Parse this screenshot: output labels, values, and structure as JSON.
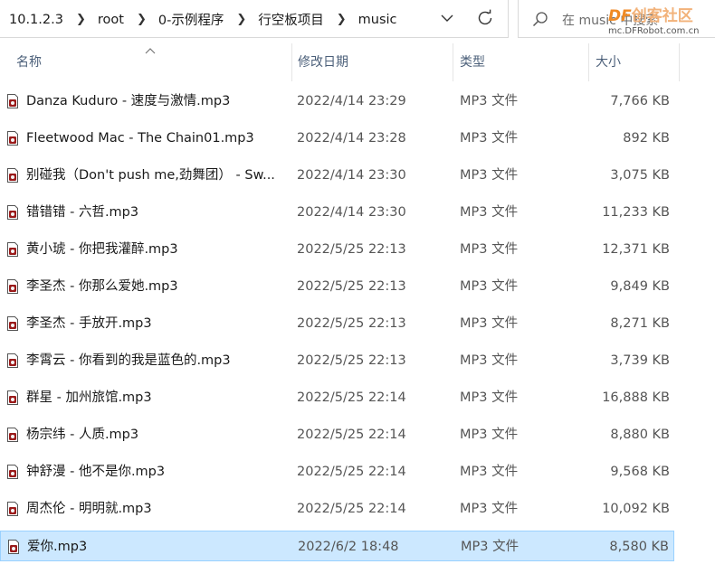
{
  "breadcrumb": [
    "10.1.2.3",
    "root",
    "0-示例程序",
    "行空板项目",
    "music"
  ],
  "search": {
    "placeholder": "在 music 中搜索"
  },
  "watermark": {
    "logo_df": "DF",
    "logo_cn": "创客社区",
    "url": "mc.DFRobot.com.cn"
  },
  "columns": {
    "name": "名称",
    "date": "修改日期",
    "type": "类型",
    "size": "大小"
  },
  "files": [
    {
      "name": "Danza Kuduro - 速度与激情.mp3",
      "date": "2022/4/14 23:29",
      "type": "MP3 文件",
      "size": "7,766 KB"
    },
    {
      "name": "Fleetwood Mac - The Chain01.mp3",
      "date": "2022/4/14 23:28",
      "type": "MP3 文件",
      "size": "892 KB"
    },
    {
      "name": "别碰我（Don't push me,劲舞团） - Sw...",
      "date": "2022/4/14 23:30",
      "type": "MP3 文件",
      "size": "3,075 KB"
    },
    {
      "name": "错错错 - 六哲.mp3",
      "date": "2022/4/14 23:30",
      "type": "MP3 文件",
      "size": "11,233 KB"
    },
    {
      "name": "黄小琥 - 你把我灌醉.mp3",
      "date": "2022/5/25 22:13",
      "type": "MP3 文件",
      "size": "12,371 KB"
    },
    {
      "name": "李圣杰 - 你那么爱她.mp3",
      "date": "2022/5/25 22:13",
      "type": "MP3 文件",
      "size": "9,849 KB"
    },
    {
      "name": "李圣杰 - 手放开.mp3",
      "date": "2022/5/25 22:13",
      "type": "MP3 文件",
      "size": "8,271 KB"
    },
    {
      "name": "李霄云 - 你看到的我是蓝色的.mp3",
      "date": "2022/5/25 22:13",
      "type": "MP3 文件",
      "size": "3,739 KB"
    },
    {
      "name": "群星 - 加州旅馆.mp3",
      "date": "2022/5/25 22:14",
      "type": "MP3 文件",
      "size": "16,888 KB"
    },
    {
      "name": "杨宗纬 - 人质.mp3",
      "date": "2022/5/25 22:14",
      "type": "MP3 文件",
      "size": "8,880 KB"
    },
    {
      "name": "钟舒漫 - 他不是你.mp3",
      "date": "2022/5/25 22:14",
      "type": "MP3 文件",
      "size": "9,568 KB"
    },
    {
      "name": "周杰伦 - 明明就.mp3",
      "date": "2022/5/25 22:14",
      "type": "MP3 文件",
      "size": "10,092 KB"
    },
    {
      "name": "爱你.mp3",
      "date": "2022/6/2 18:48",
      "type": "MP3 文件",
      "size": "8,580 KB",
      "selected": true
    }
  ],
  "colors": {
    "selection_bg": "#cce8ff",
    "selection_border": "#99d1ff",
    "header_text": "#4c607a"
  },
  "icons": {
    "file": "mp3-file-icon",
    "dropdown": "chevron-down-icon",
    "refresh": "refresh-icon",
    "search": "search-icon",
    "sort": "sort-ascending-icon"
  }
}
